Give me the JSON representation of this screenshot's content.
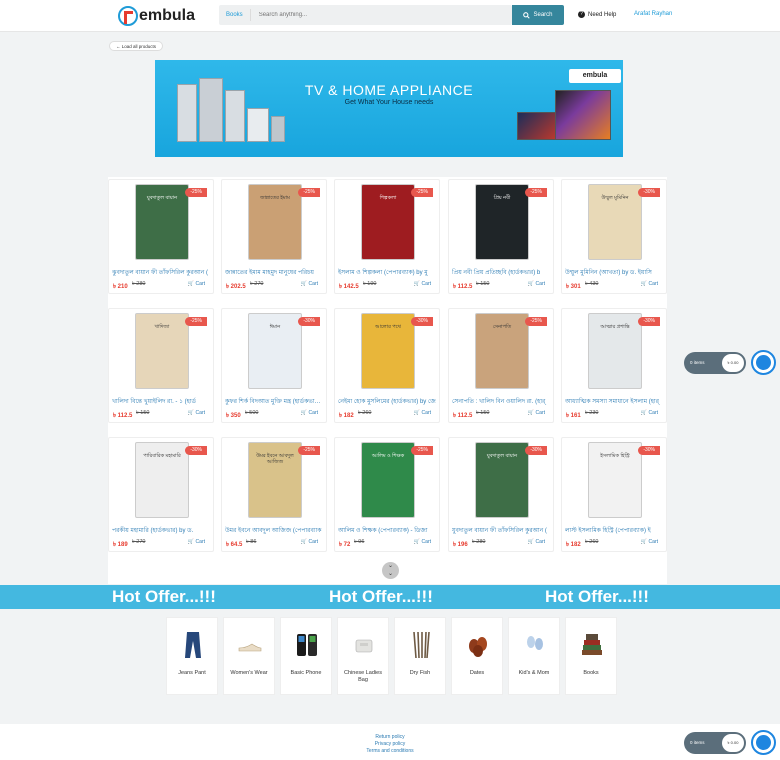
{
  "header": {
    "logo_text": "embula",
    "search_category": "Books",
    "search_placeholder": "Search anything...",
    "search_button": "Search",
    "help_label": "Need Help",
    "help_icon_glyph": "?",
    "user_name": "Arafat Rayhan"
  },
  "nav": {
    "back_label": "Load all products"
  },
  "banner": {
    "title": "TV & HOME APPLIANCE",
    "subtitle": "Get What Your House needs",
    "logo_text": "embula"
  },
  "products": [
    {
      "title": "ঝুবদাতুল বায়ান ফী তাঁফসিরিল কুরআন (",
      "price": "৳ 210",
      "old": "৳ 280",
      "discount": "-25%",
      "cart": "Cart",
      "cover_color": "#3e6e47",
      "cover_title": "যুবদাতুল বায়ান"
    },
    {
      "title": "জান্নাতের ইমাম মাহমুদ মানুষের পরিচয়",
      "price": "৳ 202.5",
      "old": "৳ 270",
      "discount": "-25%",
      "cart": "Cart",
      "cover_color": "#caa074",
      "cover_title": "জান্নাতের ইমাম"
    },
    {
      "title": "ইসলাম ও শিল্পকলা (পেপারব্যাক) by মু",
      "price": "৳ 142.5",
      "old": "৳ 190",
      "discount": "-25%",
      "cart": "Cart",
      "cover_color": "#9e1c20",
      "cover_title": "শিল্পকলা"
    },
    {
      "title": "প্রিয় নবী প্রিয় প্রতিচ্ছবি (হার্ডকভার) b",
      "price": "৳ 112.5",
      "old": "৳ 150",
      "discount": "-25%",
      "cart": "Cart",
      "cover_color": "#1f2528",
      "cover_title": "প্রিয় নবী"
    },
    {
      "title": "উম্মুল মুমিনিন (আখতা) by ড. ইয়াসি",
      "price": "৳ 301",
      "old": "৳ 430",
      "discount": "-30%",
      "cart": "Cart",
      "cover_color": "#e8d9b7",
      "cover_title": "উম্মুল মুমিনিন"
    },
    {
      "title": "খালিদা বিন্তে খুয়াইলিদ রা. - ১ (হার্ড",
      "price": "৳ 112.5",
      "old": "৳ 150",
      "discount": "-25%",
      "cart": "Cart",
      "cover_color": "#e6d6b9",
      "cover_title": "খাদিজা"
    },
    {
      "title": "কুফর শির্ক বিদআত মুক্তি মন্ত্র (হার্ডকভার) by",
      "price": "৳ 350",
      "old": "৳ 500",
      "discount": "-30%",
      "cart": "Cart",
      "cover_color": "#e9eef3",
      "cover_title": "ঈমান"
    },
    {
      "title": "নেইমা হোক মুসলিমের (হার্ডকভার) by জে",
      "price": "৳ 182",
      "old": "৳ 260",
      "discount": "-30%",
      "cart": "Cart",
      "cover_color": "#e8b63a",
      "cover_title": "আলোর পথে"
    },
    {
      "title": "সেনাপতি : খালিদ বিন ওয়ালিদ রা. (হার্",
      "price": "৳ 112.5",
      "old": "৳ 150",
      "discount": "-25%",
      "cart": "Cart",
      "cover_color": "#c9a37c",
      "cover_title": "সেনাপতি"
    },
    {
      "title": "আধ্যাত্মিক সমস্যা সমাধানে ইসলাম (হার্",
      "price": "৳ 161",
      "old": "৳ 230",
      "discount": "-30%",
      "cart": "Cart",
      "cover_color": "#e4e8ea",
      "cover_title": "আত্মার প্রশান্তি"
    },
    {
      "title": "পরকীয় মহামারি (হার্ডকভার) by ড.",
      "price": "৳ 189",
      "old": "৳ 270",
      "discount": "-30%",
      "cart": "Cart",
      "cover_color": "#eeeeee",
      "cover_title": "পারিবারিক মহামারি"
    },
    {
      "title": "উমর ইবনে আবদুল আজিজ (পেপারব্যাক",
      "price": "৳ 64.5",
      "old": "৳ 86",
      "discount": "-25%",
      "cart": "Cart",
      "cover_color": "#d9c28a",
      "cover_title": "উমর ইবনে আবদুল আজিজ"
    },
    {
      "title": "আলিম ও শিক্ষক (পেপারব্যাক) - ডিজা",
      "price": "৳ 72",
      "old": "৳ 96",
      "discount": "-25%",
      "cart": "Cart",
      "cover_color": "#2f8a4a",
      "cover_title": "আলিম ও শিক্ষক"
    },
    {
      "title": "যুবদাতুল বায়ান ফী তাঁফসিরিল কুরআন (",
      "price": "৳ 196",
      "old": "৳ 280",
      "discount": "-30%",
      "cart": "Cart",
      "cover_color": "#3e6e47",
      "cover_title": "যুবদাতুল বায়ান"
    },
    {
      "title": "লাস্ট ইসলামিক হিস্ট্রি (পেপারব্যাক) ই",
      "price": "৳ 182",
      "old": "৳ 260",
      "discount": "-30%",
      "cart": "Cart",
      "cover_color": "#f2f2f2",
      "cover_title": "ইসলামিক হিস্ট্রি"
    }
  ],
  "scroll_glyph": "⌄",
  "hot_offer": [
    "Hot Offer...!!!",
    "Hot Offer...!!!",
    "Hot Offer...!!!"
  ],
  "categories": [
    {
      "label": "Jeans Pant",
      "icon": "jeans-icon"
    },
    {
      "label": "Women's Wear",
      "icon": "women-shoe-icon"
    },
    {
      "label": "Basic Phone",
      "icon": "phone-icon"
    },
    {
      "label": "Chinese Ladies Bag",
      "icon": "bag-icon"
    },
    {
      "label": "Dry Fish",
      "icon": "dry-fish-icon"
    },
    {
      "label": "Dates",
      "icon": "dates-icon"
    },
    {
      "label": "Kid's & Mom",
      "icon": "baby-shoes-icon"
    },
    {
      "label": "Books",
      "icon": "books-icon"
    }
  ],
  "footer": {
    "links": [
      "Return policy",
      "Privacy policy",
      "Terms and conditions"
    ]
  },
  "floating_cart": {
    "items": "0 items",
    "total": "৳ 0.00"
  },
  "colors": {
    "accent": "#1e9bd7",
    "search_button": "#35869c",
    "discount": "#e8574d",
    "price": "#e63b2e",
    "hot_offer_bg": "#44b8e0"
  }
}
